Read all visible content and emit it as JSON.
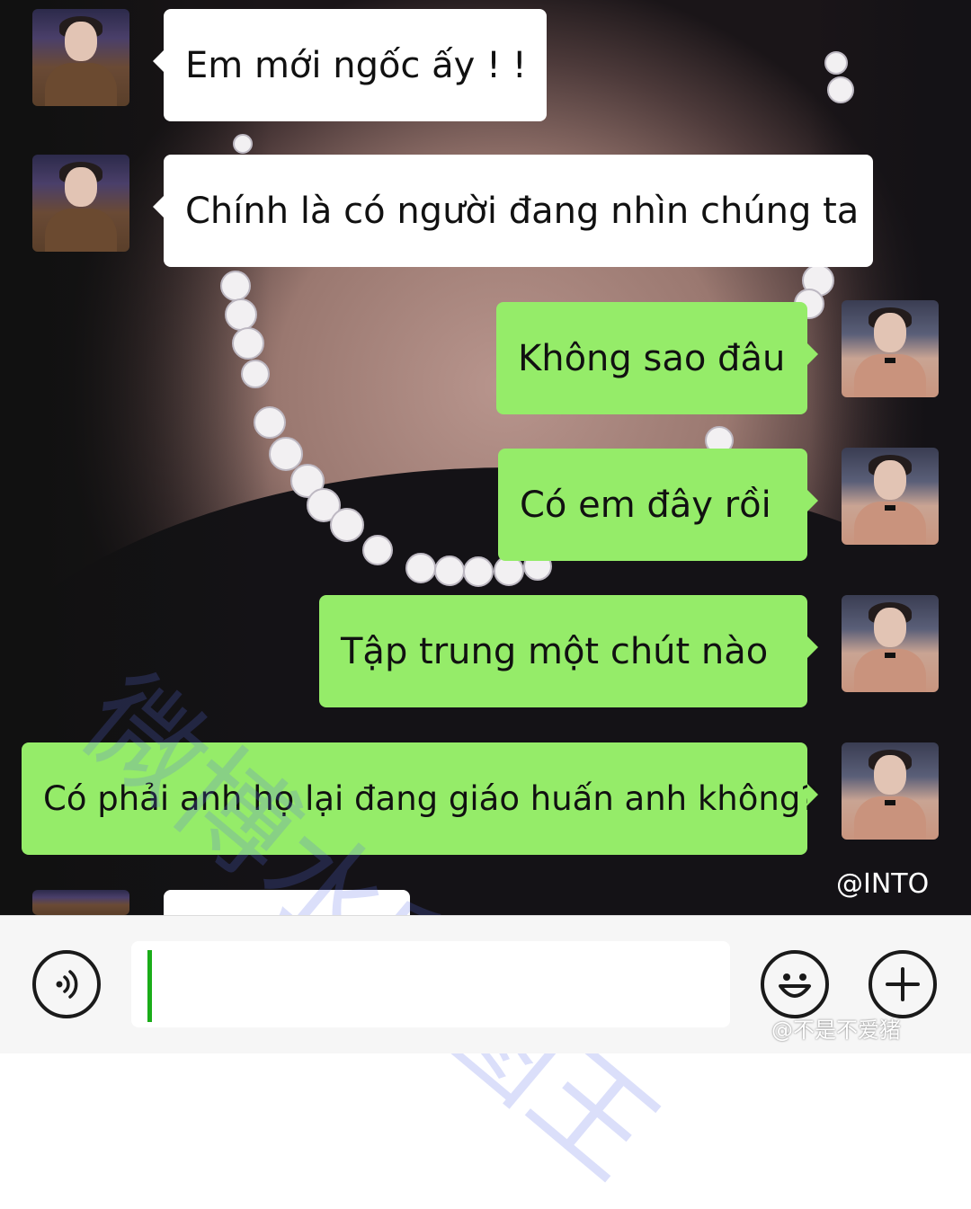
{
  "messages": [
    {
      "side": "in",
      "text": "Em mới ngốc ấy ! !"
    },
    {
      "side": "in",
      "text": "Chính là có người đang nhìn chúng ta"
    },
    {
      "side": "out",
      "text": "Không sao đâu"
    },
    {
      "side": "out",
      "text": "Có em đây rồi"
    },
    {
      "side": "out",
      "text": "Tập trung một chút nào"
    },
    {
      "side": "out",
      "text": "Có phải anh họ lại đang giáo huấn anh không?"
    }
  ],
  "background_watermark": "@INTO",
  "diagonal_watermark": "微博水印图王",
  "composer": {
    "input_value": "",
    "voice_icon": "voice-icon",
    "emoji_icon": "emoji-icon",
    "plus_icon": "plus-icon",
    "watermark": "@不是不爱猪"
  },
  "colors": {
    "incoming_bubble": "#ffffff",
    "outgoing_bubble": "#95ec69",
    "caret": "#1aad19",
    "composer_bg": "#f6f6f6"
  }
}
